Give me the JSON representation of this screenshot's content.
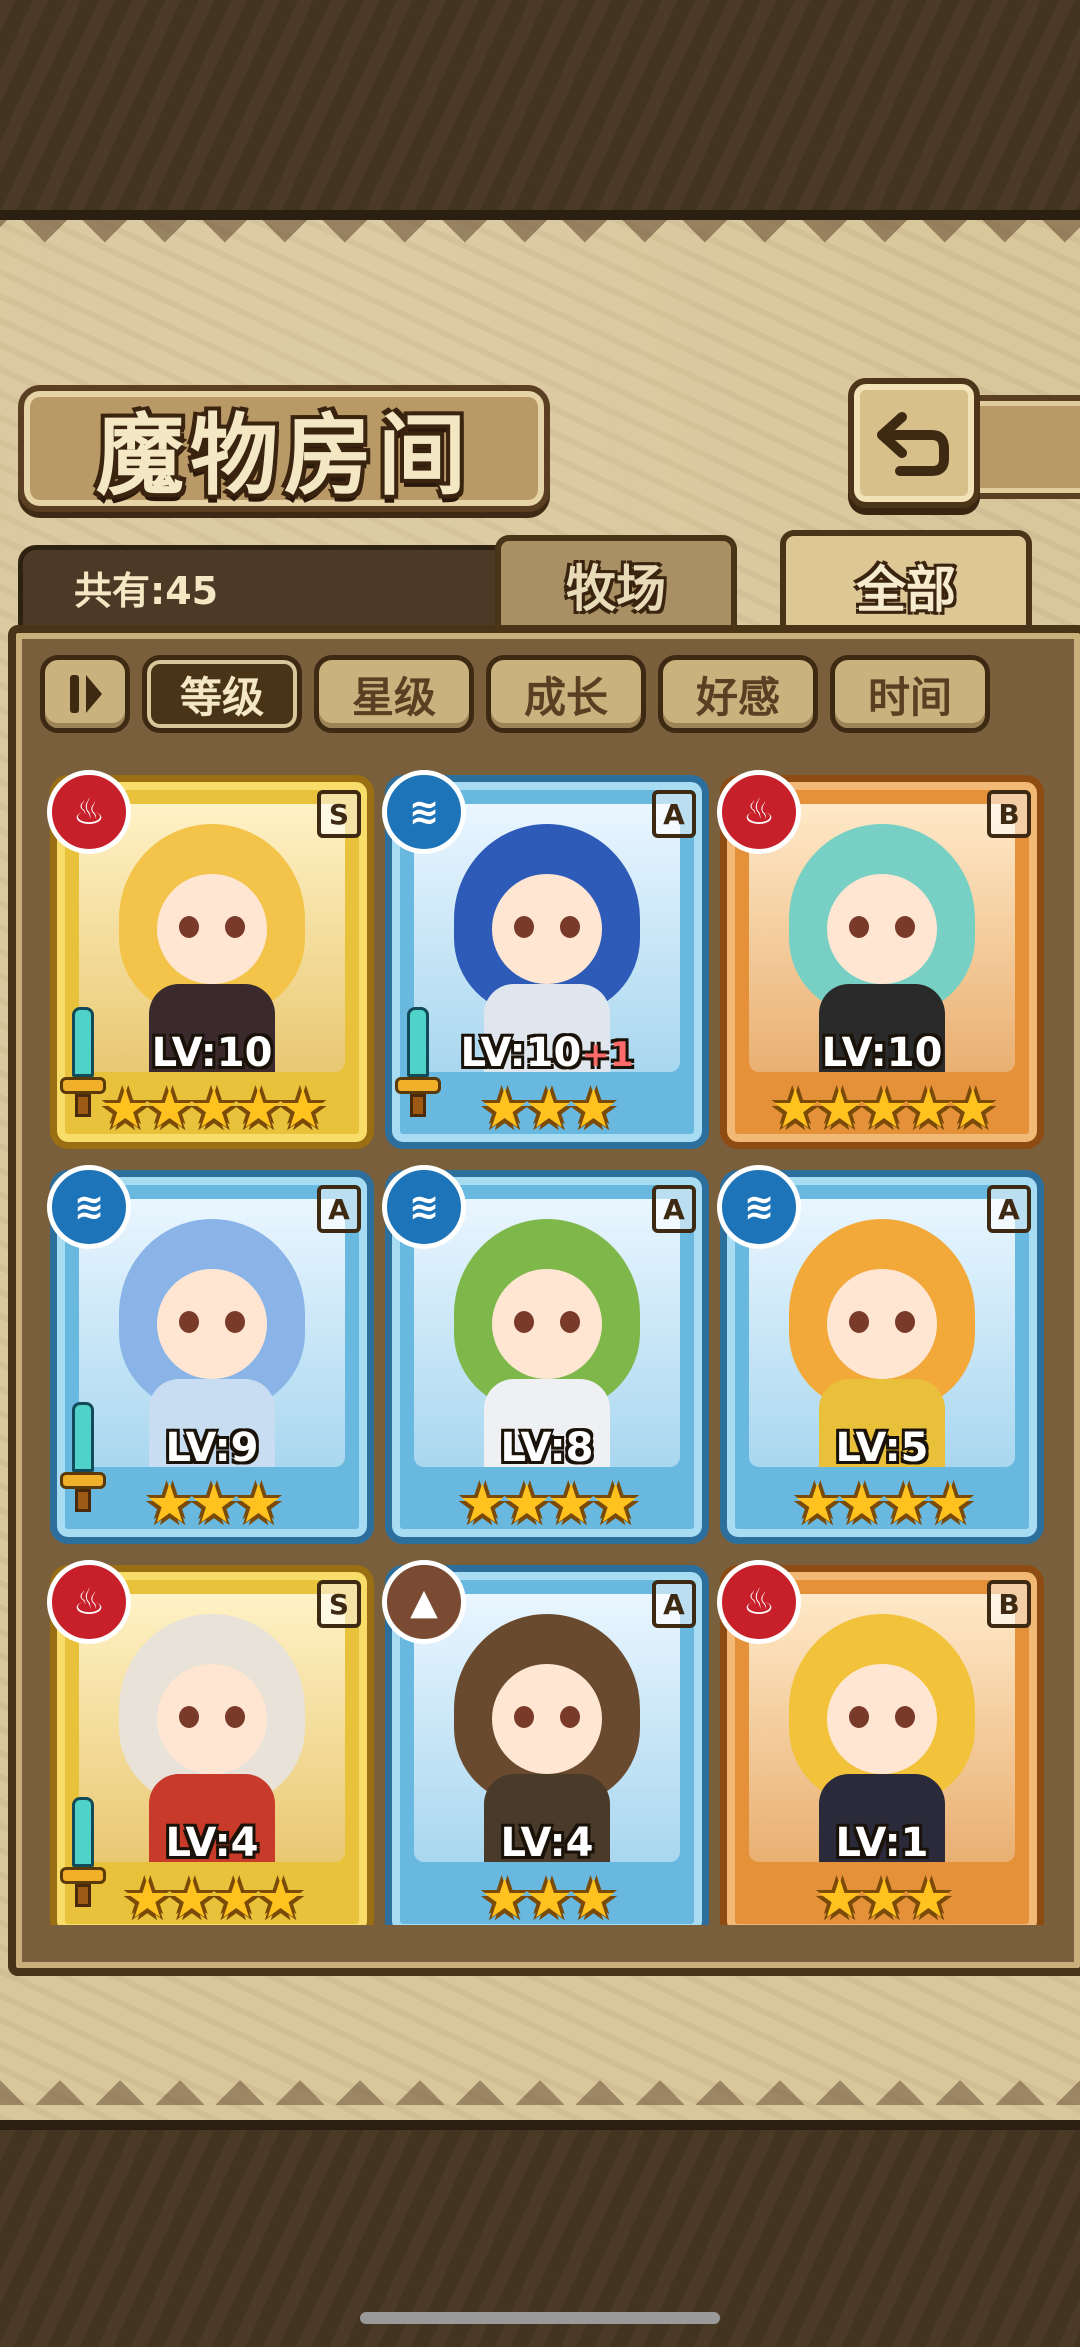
{
  "title": "魔物房间",
  "count_label": "共有:45",
  "tabs": [
    {
      "label": "牧场",
      "active": false
    },
    {
      "label": "全部",
      "active": true
    }
  ],
  "filters": {
    "toggle_icon": "sort-toggle-icon",
    "items": [
      {
        "label": "等级",
        "active": true
      },
      {
        "label": "星级",
        "active": false
      },
      {
        "label": "成长",
        "active": false
      },
      {
        "label": "好感",
        "active": false
      },
      {
        "label": "时间",
        "active": false
      }
    ]
  },
  "monsters": [
    {
      "element": "fire",
      "rank": "S",
      "level": "LV:10",
      "bonus": "",
      "stars": "★★★★★",
      "equipped": true,
      "hair": "#f3c34a",
      "body": "#3a2a2e"
    },
    {
      "element": "water",
      "rank": "A",
      "level": "LV:10",
      "bonus": "+1",
      "stars": "★★★",
      "equipped": true,
      "hair": "#2e5bb8",
      "body": "#dfe6ee"
    },
    {
      "element": "fire",
      "rank": "B",
      "level": "LV:10",
      "bonus": "",
      "stars": "★★★★★",
      "equipped": false,
      "hair": "#78cfc4",
      "body": "#2a2a2a"
    },
    {
      "element": "water",
      "rank": "A",
      "level": "LV:9",
      "bonus": "",
      "stars": "★★★",
      "equipped": true,
      "hair": "#8ab4e8",
      "body": "#c8dcf2"
    },
    {
      "element": "water",
      "rank": "A",
      "level": "LV:8",
      "bonus": "",
      "stars": "★★★★",
      "equipped": false,
      "hair": "#7fb84a",
      "body": "#eef0f4"
    },
    {
      "element": "water",
      "rank": "A",
      "level": "LV:5",
      "bonus": "",
      "stars": "★★★★",
      "equipped": false,
      "hair": "#f2a93a",
      "body": "#e8c03a"
    },
    {
      "element": "fire",
      "rank": "S",
      "level": "LV:4",
      "bonus": "",
      "stars": "★★★★",
      "equipped": true,
      "hair": "#e8e2d8",
      "body": "#c83a2a"
    },
    {
      "element": "earth",
      "rank": "A",
      "level": "LV:4",
      "bonus": "",
      "stars": "★★★",
      "equipped": false,
      "hair": "#6a4a2e",
      "body": "#4a3a2a"
    },
    {
      "element": "fire",
      "rank": "B",
      "level": "LV:1",
      "bonus": "",
      "stars": "★★★",
      "equipped": false,
      "hair": "#f2c23a",
      "body": "#2a2a3a"
    }
  ],
  "colors": {
    "fire": "#c8202a",
    "water": "#1e74b8",
    "earth": "#7a4a32",
    "rank_S_frame": "#e8c23a",
    "rank_A_frame": "#69b8e0",
    "rank_B_frame": "#e4913a"
  }
}
